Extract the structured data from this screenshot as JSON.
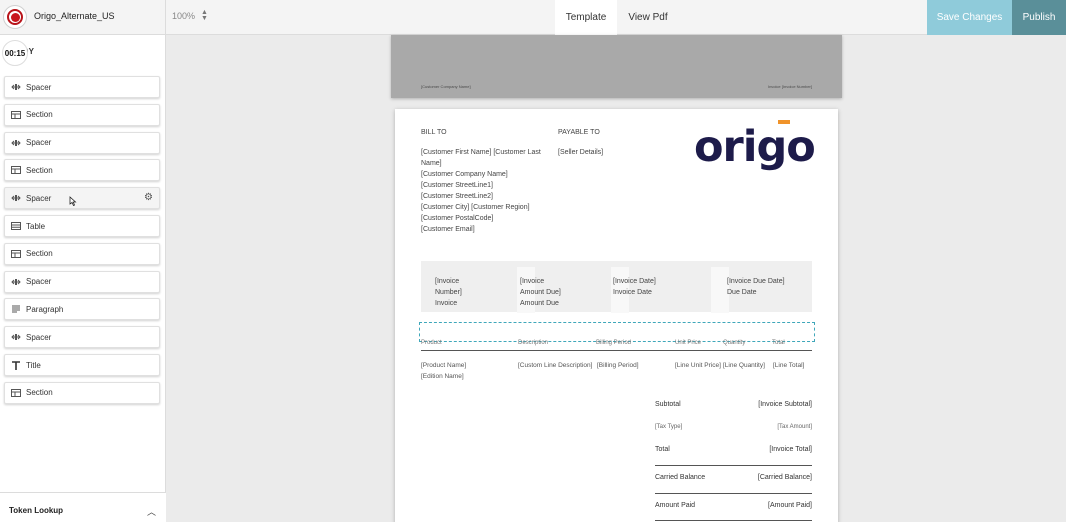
{
  "header": {
    "app_title": "Origo_Alternate_US",
    "zoom": "100%",
    "tabs": [
      "Template",
      "View Pdf"
    ],
    "save_label": "Save Changes",
    "publish_label": "Publish",
    "colors": {
      "save": "#8fcbda",
      "publish": "#5a8f99",
      "record": "#c8161d"
    }
  },
  "sidebar": {
    "timer": "00:15",
    "section_label": "BODY",
    "blocks": [
      {
        "label": "Spacer",
        "icon": "spacer-icon"
      },
      {
        "label": "Section",
        "icon": "section-icon"
      },
      {
        "label": "Spacer",
        "icon": "spacer-icon"
      },
      {
        "label": "Section",
        "icon": "section-icon"
      },
      {
        "label": "Spacer",
        "icon": "spacer-icon"
      },
      {
        "label": "Table",
        "icon": "table-icon"
      },
      {
        "label": "Section",
        "icon": "section-icon"
      },
      {
        "label": "Spacer",
        "icon": "spacer-icon"
      },
      {
        "label": "Paragraph",
        "icon": "paragraph-icon"
      },
      {
        "label": "Spacer",
        "icon": "spacer-icon"
      },
      {
        "label": "Title",
        "icon": "title-icon"
      },
      {
        "label": "Section",
        "icon": "section-icon"
      }
    ],
    "token_lookup": "Token Lookup"
  },
  "page_header": {
    "left": "[Customer Company Name]",
    "right": "Invoice [Invoice Number]"
  },
  "invoice": {
    "logo_text": "origo",
    "bill_to_label": "BILL TO",
    "payable_to_label": "PAYABLE TO",
    "bill_to_lines": [
      "[Customer First Name] [Customer Last",
      "Name]",
      "[Customer Company Name]",
      "[Customer StreetLine1]",
      "[Customer StreetLine2]",
      "[Customer City] [Customer Region]",
      "[Customer PostalCode]",
      "[Customer Email]"
    ],
    "payable_to_value": "[Seller Details]",
    "info_columns": [
      [
        "[Invoice",
        "Number]",
        "Invoice"
      ],
      [
        "[Invoice",
        "Amount Due]",
        "Amount Due"
      ],
      [
        "[Invoice Date]",
        "Invoice Date"
      ],
      [
        "[Invoice Due Date]",
        "Due Date"
      ]
    ],
    "table_headers": [
      "Product",
      "Description",
      "Billing Period",
      "Unit Price",
      "Quantity",
      "Total"
    ],
    "line_item": {
      "product": [
        "[Product Name]",
        "[Edition Name]"
      ],
      "description": "[Custom Line Description]",
      "billing_period": "[Billing Period]",
      "unit_price": "[Line Unit Price]",
      "quantity": "[Line Quantity]",
      "total": "[Line Total]"
    },
    "summary": [
      {
        "label": "Subtotal",
        "value": "[Invoice Subtotal]"
      },
      {
        "label": "[Tax Type]",
        "value": "[Tax Amount]"
      },
      {
        "label": "Total",
        "value": "[Invoice Total]"
      },
      {
        "label": "Carried Balance",
        "value": "[Carried Balance]"
      },
      {
        "label": "Amount Paid",
        "value": "[Amount Paid]"
      }
    ]
  }
}
